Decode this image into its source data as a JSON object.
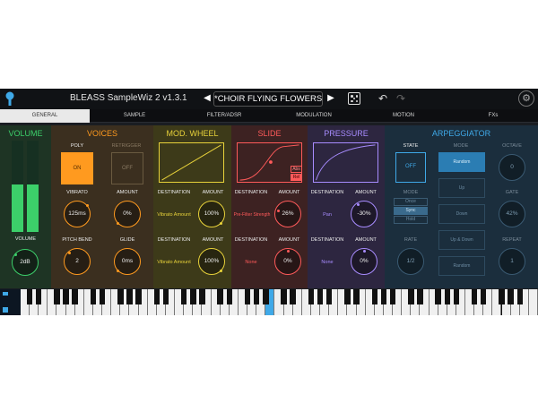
{
  "topbar": {
    "app_name": "BLEASS SampleWiz 2  v1.3.1",
    "preset_name": "*CHOIR FLYING FLOWERS",
    "prev_glyph": "◀",
    "next_glyph": "▶",
    "undo_glyph": "↶",
    "redo_glyph": "↷",
    "settings_glyph": "⚙"
  },
  "tabs": [
    {
      "label": "GENERAL"
    },
    {
      "label": "SAMPLE"
    },
    {
      "label": "FILTER/ADSR"
    },
    {
      "label": "MODULATION"
    },
    {
      "label": "MOTION"
    },
    {
      "label": "FXs"
    }
  ],
  "volume": {
    "title": "VOLUME",
    "knob_label": "VOLUME",
    "knob_value": "2dB",
    "level_left": 0.52,
    "level_right": 0.52
  },
  "voices": {
    "title": "VOICES",
    "poly_label": "POLY",
    "poly_value": "ON",
    "retrigger_label": "RETRIGGER",
    "retrigger_value": "OFF",
    "vibrato_label": "VIBRATO",
    "vibrato_value": "125ms",
    "amount_label": "AMOUNT",
    "amount_value": "0%",
    "pitchbend_label": "PITCH BEND",
    "pitchbend_value": "2",
    "glide_label": "GLIDE",
    "glide_value": "0ms"
  },
  "modwheel": {
    "title": "MOD. WHEEL",
    "dest1_label": "DESTINATION",
    "dest1_value": "Vibrato Amount",
    "amt1_label": "AMOUNT",
    "amt1_value": "100%",
    "dest2_label": "DESTINATION",
    "dest2_value": "Vibrato Amount",
    "amt2_label": "AMOUNT",
    "amt2_value": "100%"
  },
  "slide": {
    "title": "SLIDE",
    "abs_label": "Abs",
    "rel_label": "Rel",
    "dest1_label": "DESTINATION",
    "dest1_value": "Pre-Filter Strength",
    "amt1_label": "AMOUNT",
    "amt1_value": "26%",
    "dest2_label": "DESTINATION",
    "dest2_value": "None",
    "amt2_label": "AMOUNT",
    "amt2_value": "0%"
  },
  "pressure": {
    "title": "PRESSURE",
    "dest1_label": "DESTINATION",
    "dest1_value": "Pan",
    "amt1_label": "AMOUNT",
    "amt1_value": "-30%",
    "dest2_label": "DESTINATION",
    "dest2_value": "None",
    "amt2_label": "AMOUNT",
    "amt2_value": "0%"
  },
  "arpeggiator": {
    "title": "ARPEGGIATOR",
    "state_label": "STATE",
    "state_value": "OFF",
    "mode_label": "MODE",
    "mode_options": [
      "Random",
      "Up",
      "Down",
      "Up & Down",
      "Random"
    ],
    "mode2_label": "MODE",
    "mode2_options": [
      "Once",
      "Sync",
      "Hold"
    ],
    "rate_label": "RATE",
    "rate_value": "1/2",
    "octave_label": "OCTAVE",
    "octave_value": "0",
    "gate_label": "GATE",
    "gate_value": "42%",
    "repeat_label": "REPEAT",
    "repeat_value": "1"
  },
  "colors": {
    "volume": "#3ccf6a",
    "voices": "#ff9a1f",
    "modwheel": "#e8d23a",
    "slide": "#ff5a5a",
    "pressure": "#a88cff",
    "arp": "#3fa9e8"
  }
}
